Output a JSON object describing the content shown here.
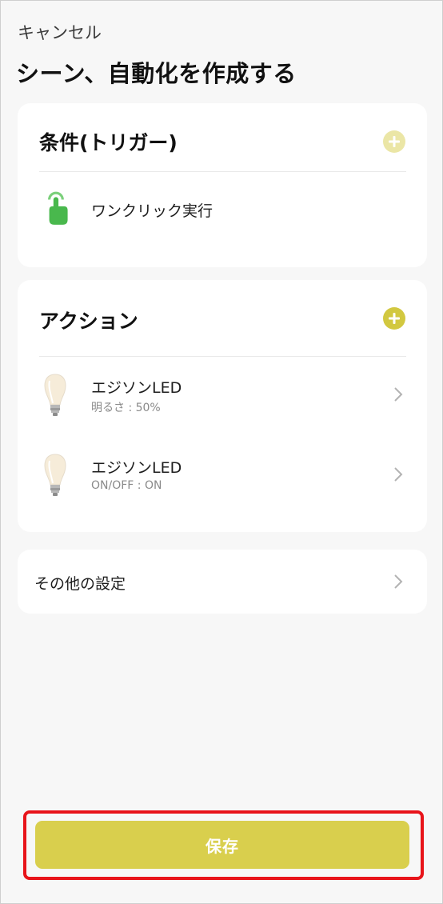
{
  "header": {
    "cancel_label": "キャンセル",
    "title": "シーン、自動化を作成する"
  },
  "conditions": {
    "title": "条件(トリガー)",
    "add_icon": "plus-circle-icon",
    "add_color": "#ebe6a6",
    "items": [
      {
        "icon": "tap-hand-icon",
        "label": "ワンクリック実行"
      }
    ]
  },
  "actions": {
    "title": "アクション",
    "add_icon": "plus-circle-icon",
    "add_color": "#d2c840",
    "items": [
      {
        "icon": "edison-bulb-icon",
        "label": "エジソンLED",
        "detail": "明るさ : 50%"
      },
      {
        "icon": "edison-bulb-icon",
        "label": "エジソンLED",
        "detail": "ON/OFF : ON"
      }
    ]
  },
  "other_settings": {
    "label": "その他の設定"
  },
  "footer": {
    "save_label": "保存",
    "save_color": "#d9cf4d",
    "highlight_color": "#e8141a"
  }
}
